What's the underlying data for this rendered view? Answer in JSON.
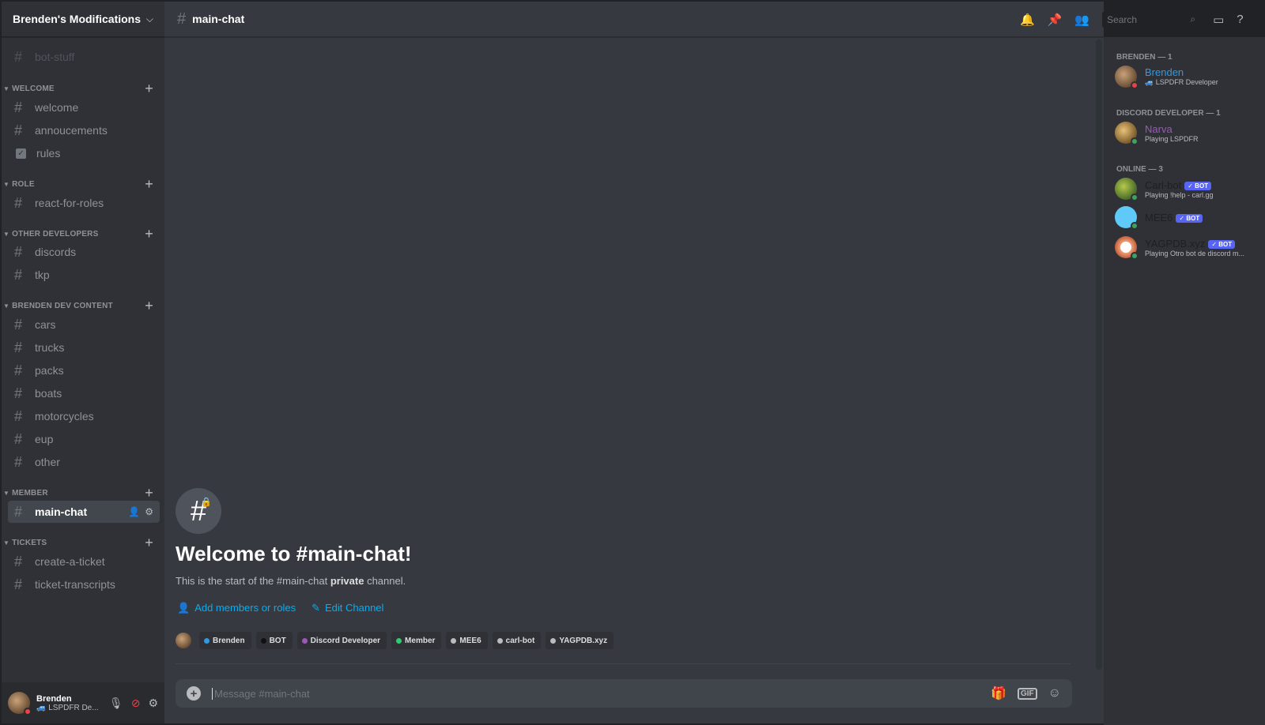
{
  "guild": {
    "name": "Brenden's Modifications"
  },
  "channel_header": {
    "title": "main-chat"
  },
  "search": {
    "placeholder": "Search"
  },
  "channels": {
    "top": "bot-stuff",
    "categories": [
      {
        "name": "WELCOME",
        "items": [
          "welcome",
          "annoucements",
          "rules"
        ]
      },
      {
        "name": "ROLE",
        "items": [
          "react-for-roles"
        ]
      },
      {
        "name": "OTHER DEVELOPERS",
        "items": [
          "discords",
          "tkp"
        ]
      },
      {
        "name": "BRENDEN DEV CONTENT",
        "items": [
          "cars",
          "trucks",
          "packs",
          "boats",
          "motorcycles",
          "eup",
          "other"
        ]
      },
      {
        "name": "MEMBER",
        "items": [
          "main-chat"
        ]
      },
      {
        "name": "TICKETS",
        "items": [
          "create-a-ticket",
          "ticket-transcripts"
        ]
      }
    ]
  },
  "user_panel": {
    "name": "Brenden",
    "status": "🚙 LSPDFR De..."
  },
  "welcome": {
    "title": "Welcome to #main-chat!",
    "sub_prefix": "This is the start of the #main-chat ",
    "sub_bold": "private",
    "sub_suffix": " channel.",
    "add_members": "Add members or roles",
    "edit_channel": "Edit Channel"
  },
  "roles": [
    {
      "name": "Brenden",
      "color": "#3498db"
    },
    {
      "name": "BOT",
      "color": "#111111"
    },
    {
      "name": "Discord Developer",
      "color": "#9b59b6"
    },
    {
      "name": "Member",
      "color": "#2ecc71"
    },
    {
      "name": "MEE6",
      "color": "#b9bbbe"
    },
    {
      "name": "carl-bot",
      "color": "#b9bbbe"
    },
    {
      "name": "YAGPDB.xyz",
      "color": "#b9bbbe"
    }
  ],
  "composer": {
    "placeholder": "Message #main-chat",
    "gif_label": "GIF"
  },
  "members": {
    "groups": [
      {
        "title": "BRENDEN — 1",
        "members": [
          {
            "name": "Brenden",
            "sub": "🚙 LSPDFR Developer",
            "color": "#3498db",
            "status": "#ed4245"
          }
        ]
      },
      {
        "title": "DISCORD DEVELOPER — 1",
        "members": [
          {
            "name": "Narva",
            "sub": "Playing LSPDFR",
            "color": "#9b59b6",
            "status": "#3ba55d"
          }
        ]
      },
      {
        "title": "ONLINE — 3",
        "members": [
          {
            "name": "Carl-bot",
            "sub": "Playing !help - carl.gg",
            "color": "#1e1f22",
            "status": "#3ba55d",
            "bot": "✓ BOT"
          },
          {
            "name": "MEE6",
            "sub": "",
            "color": "#1e1f22",
            "status": "#3ba55d",
            "bot": "✓ BOT"
          },
          {
            "name": "YAGPDB.xyz",
            "sub": "Playing Otro bot de discord m...",
            "color": "#1e1f22",
            "status": "#3ba55d",
            "bot": "✓ BOT"
          }
        ]
      }
    ]
  }
}
